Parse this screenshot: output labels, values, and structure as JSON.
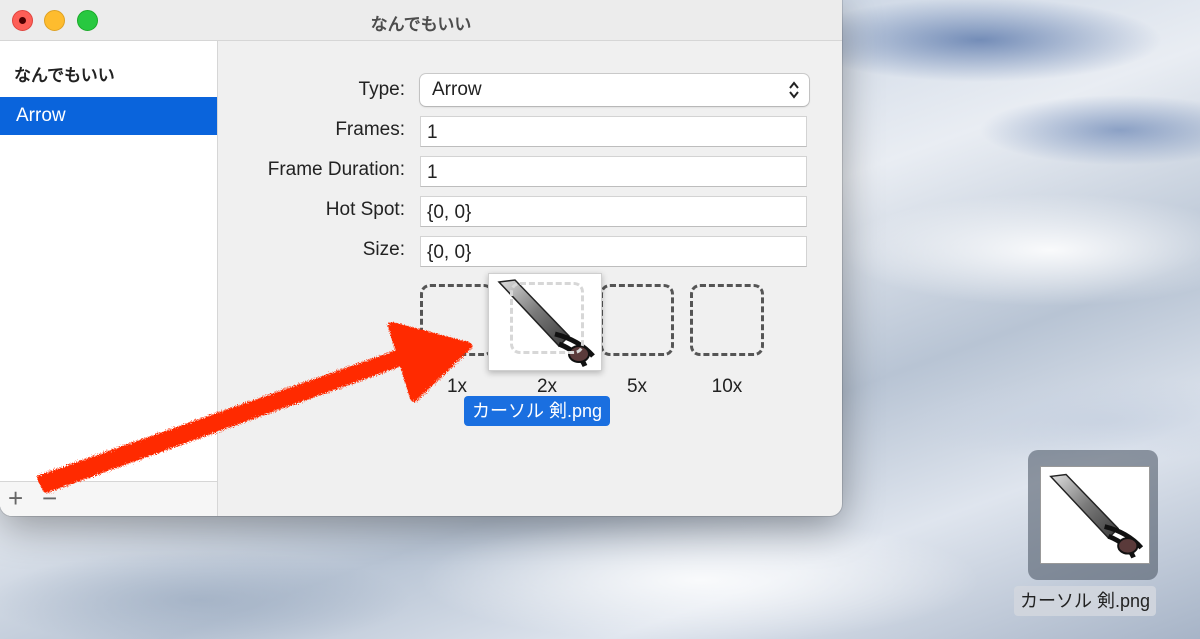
{
  "window": {
    "title": "なんでもいい"
  },
  "sidebar": {
    "header": "なんでもいい",
    "items": [
      {
        "label": "Arrow",
        "selected": true
      }
    ],
    "footer": {
      "add_label": "+",
      "remove_label": "−"
    }
  },
  "form": {
    "type_label": "Type:",
    "type_value": "Arrow",
    "frames_label": "Frames:",
    "frames_value": "1",
    "duration_label": "Frame Duration:",
    "duration_value": "1",
    "hotspot_label": "Hot Spot:",
    "hotspot_value": "{0, 0}",
    "size_label": "Size:",
    "size_value": "{0, 0}"
  },
  "wells": [
    {
      "label": "1x"
    },
    {
      "label": "2x"
    },
    {
      "label": "5x"
    },
    {
      "label": "10x"
    }
  ],
  "drag": {
    "filename": "カーソル 剣.png",
    "icon": "sword-image-icon"
  },
  "desktop": {
    "filename": "カーソル 剣.png",
    "icon": "sword-image-icon"
  },
  "colors": {
    "selection": "#0a64dc",
    "annotation_arrow": "#ff2a00"
  }
}
